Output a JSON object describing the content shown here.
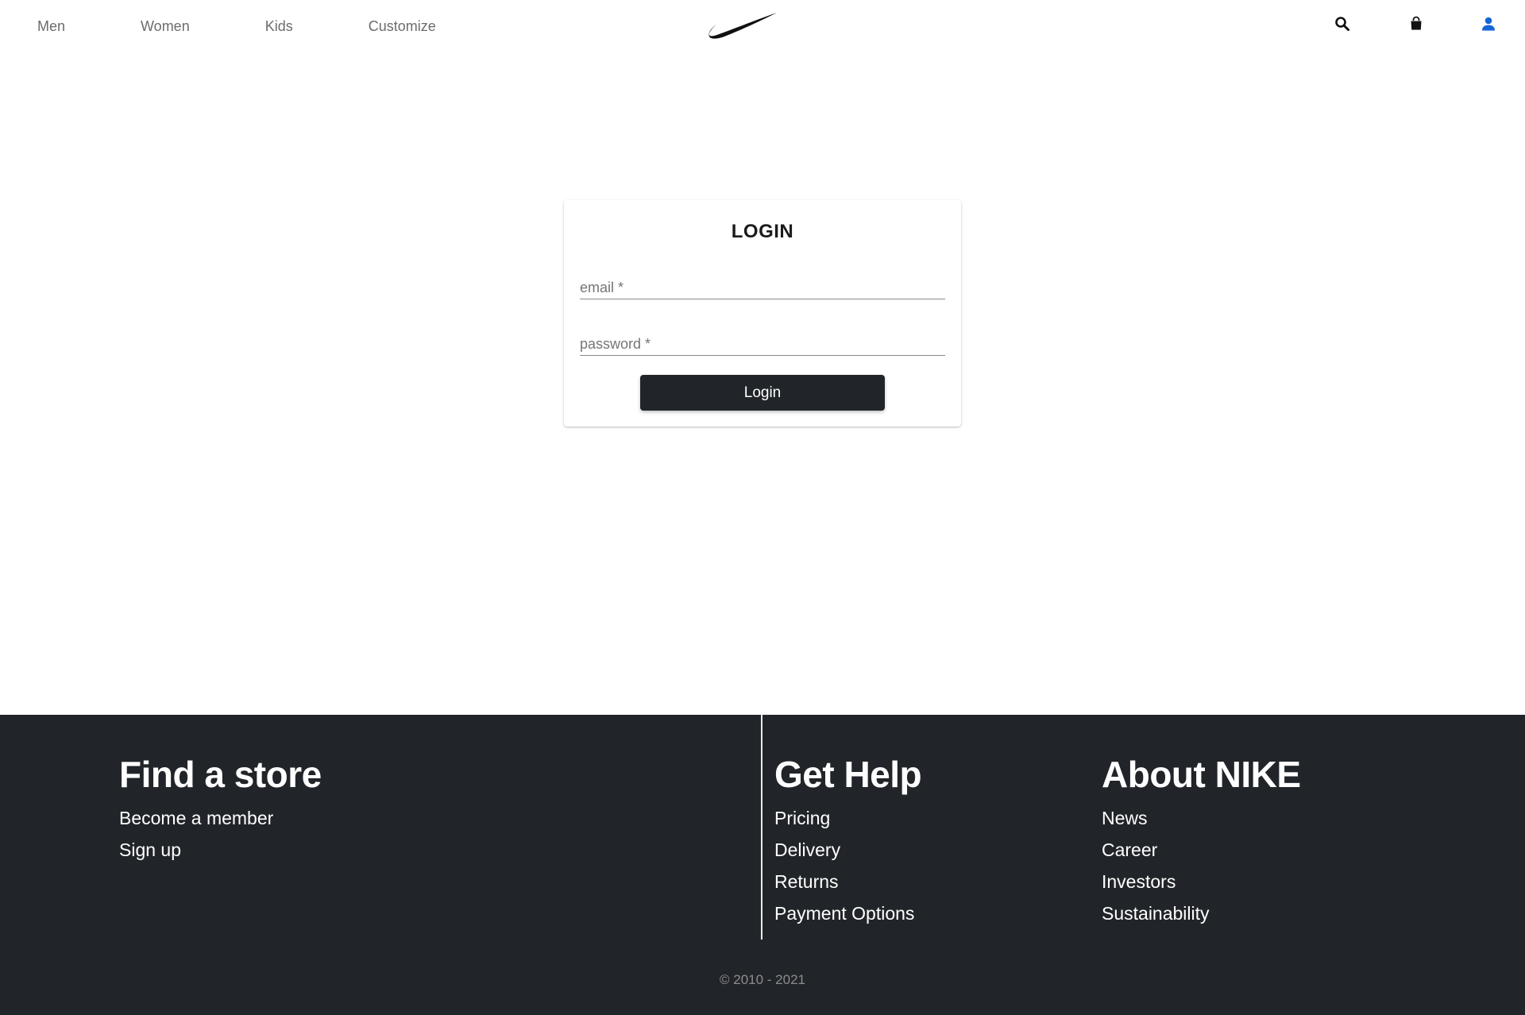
{
  "header": {
    "nav": [
      "Men",
      "Women",
      "Kids",
      "Customize"
    ],
    "icons": {
      "logo": "nike-swoosh-logo",
      "search": "search-icon",
      "bag": "shopping-bag-icon",
      "user": "user-icon"
    },
    "colors": {
      "user_icon": "#1565d8",
      "nav_text": "#6c6c6c"
    }
  },
  "login": {
    "title": "LOGIN",
    "email_placeholder": "email *",
    "password_placeholder": "password *",
    "button_label": "Login"
  },
  "footer": {
    "find_store": {
      "heading": "Find a store",
      "links": [
        "Become a member",
        "Sign up"
      ]
    },
    "get_help": {
      "heading": "Get Help",
      "links": [
        "Pricing",
        "Delivery",
        "Returns",
        "Payment Options"
      ]
    },
    "about": {
      "heading": "About NIKE",
      "links": [
        "News",
        "Career",
        "Investors",
        "Sustainability"
      ]
    },
    "copyright": "© 2010 - 2021",
    "colors": {
      "background": "#212529",
      "text": "#ffffff"
    }
  }
}
